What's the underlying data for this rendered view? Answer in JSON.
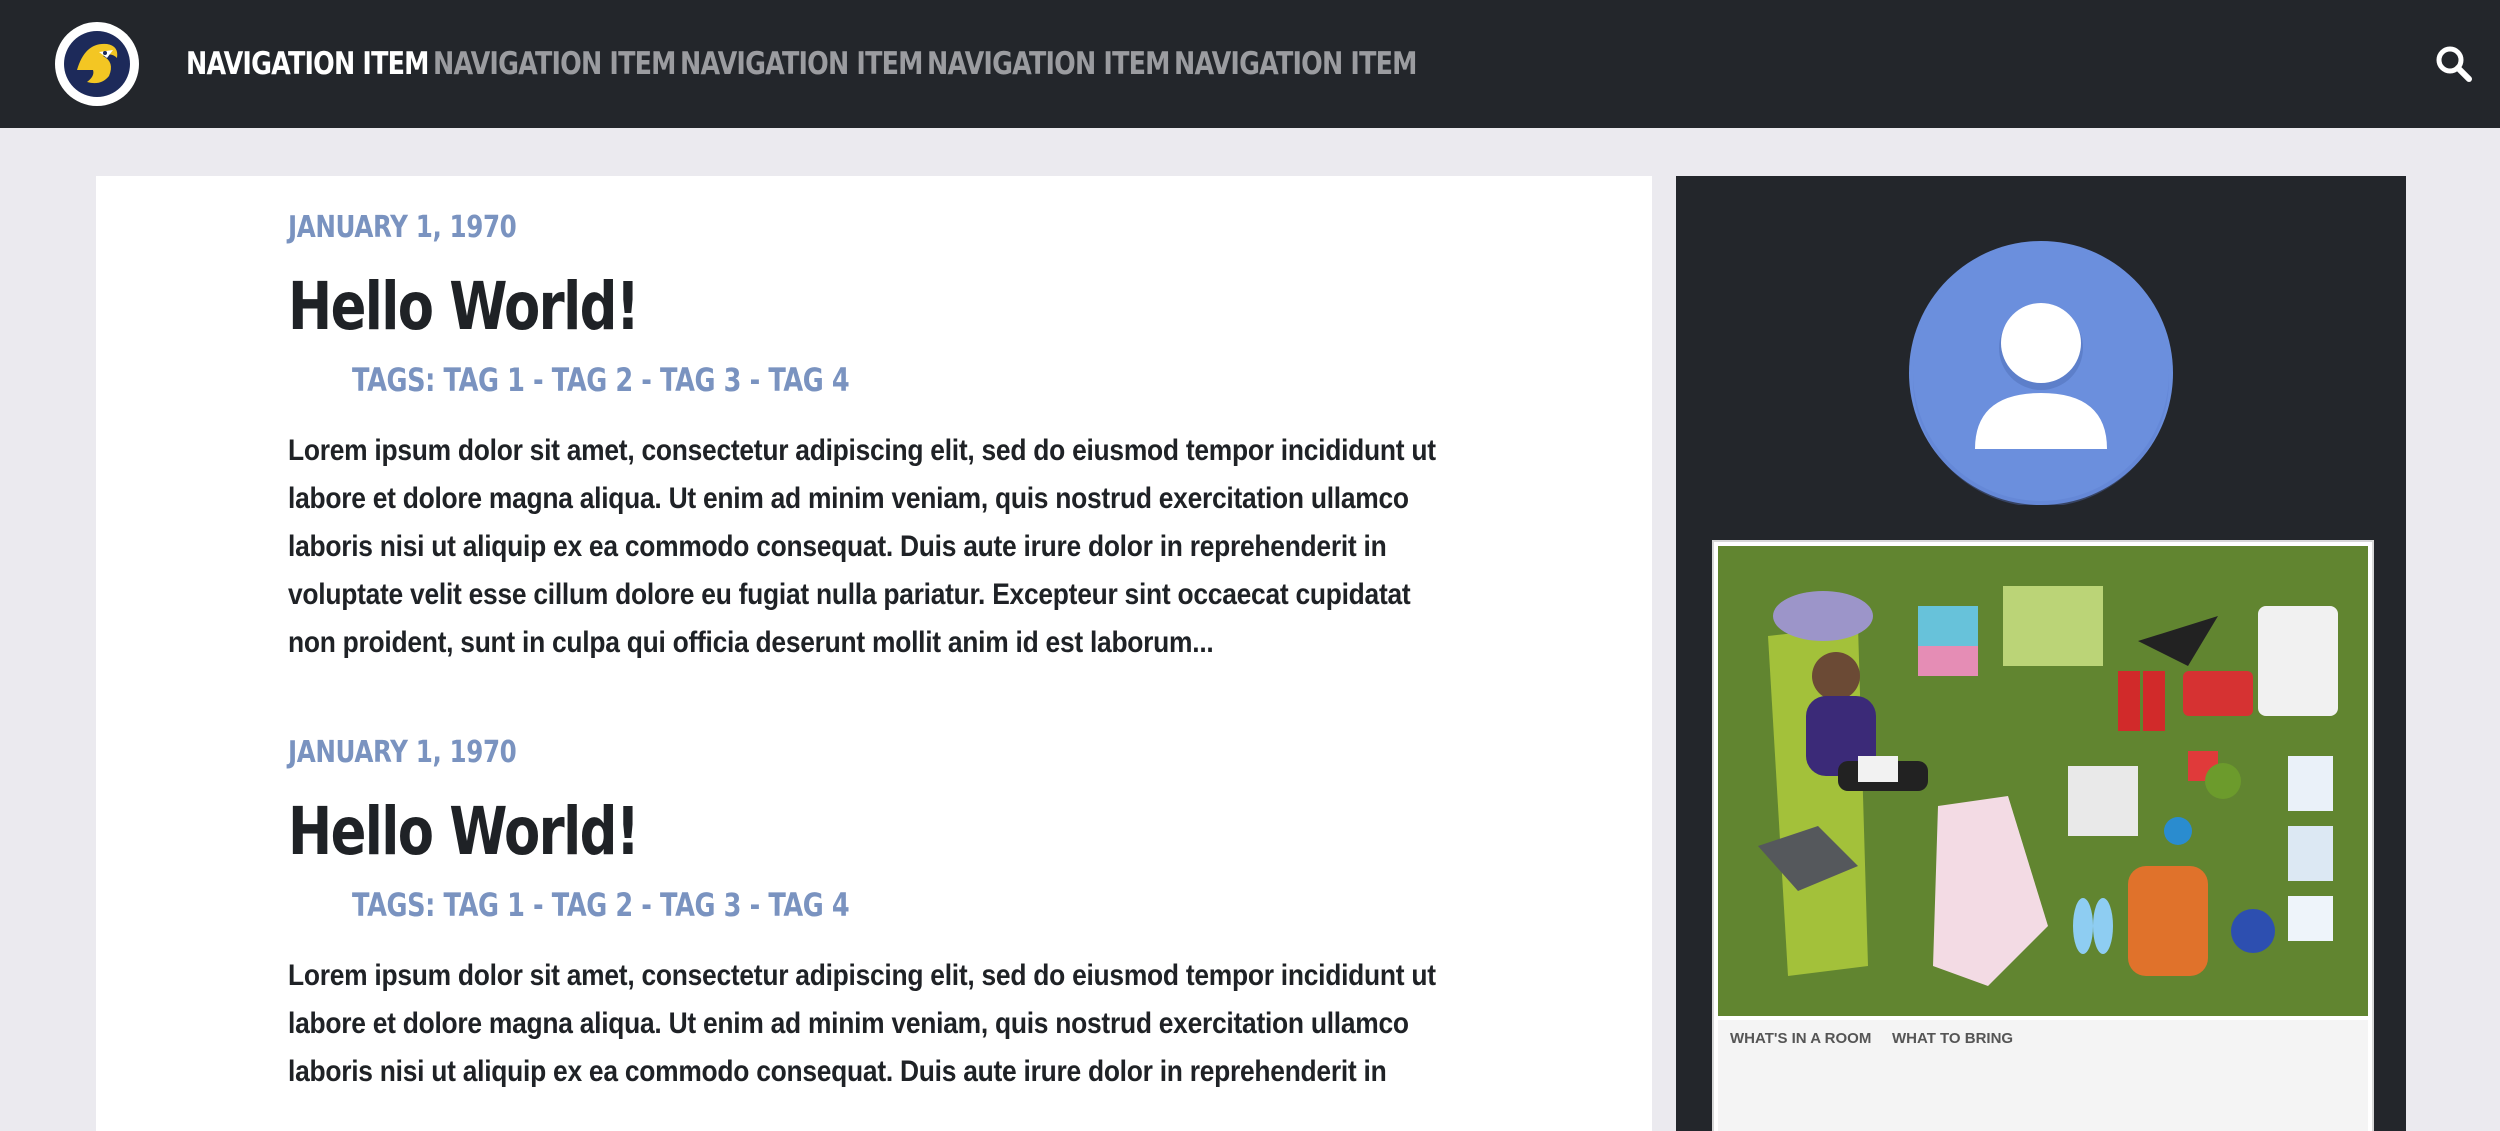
{
  "header": {
    "logo_alt": "mascot-logo",
    "nav_items": [
      {
        "label": "NAVIGATION ITEM",
        "active": true
      },
      {
        "label": "NAVIGATION ITEM",
        "active": false
      },
      {
        "label": "NAVIGATION ITEM",
        "active": false
      },
      {
        "label": "NAVIGATION ITEM",
        "active": false
      },
      {
        "label": "NAVIGATION ITEM",
        "active": false
      }
    ],
    "search_icon": "search-icon"
  },
  "posts": [
    {
      "date": "JANUARY 1, 1970",
      "title": "Hello World!",
      "tags": "TAGS: TAG 1 - TAG 2 - TAG 3 - TAG 4",
      "body": "Lorem ipsum dolor sit amet, consectetur adipiscing elit, sed do eiusmod tempor incididunt ut labore et dolore magna aliqua. Ut enim ad minim veniam, quis nostrud exercitation ullamco laboris nisi ut aliquip ex ea commodo consequat. Duis aute irure dolor in reprehenderit in voluptate velit esse cillum dolore eu fugiat nulla pariatur. Excepteur sint occaecat cupidatat non proident, sunt in culpa qui officia deserunt mollit anim id est laborum..."
    },
    {
      "date": "JANUARY 1, 1970",
      "title": "Hello World!",
      "tags": "TAGS: TAG 1 - TAG 2 - TAG 3 - TAG 4",
      "body": "Lorem ipsum dolor sit amet, consectetur adipiscing elit, sed do eiusmod tempor incididunt ut labore et dolore magna aliqua. Ut enim ad minim veniam, quis nostrud exercitation ullamco laboris nisi ut aliquip ex ea commodo consequat. Duis aute irure dolor in reprehenderit in"
    }
  ],
  "sidebar": {
    "avatar_icon": "user-avatar-icon",
    "image_headings": [
      "WHAT'S IN A ROOM",
      "WHAT TO BRING"
    ]
  },
  "colors": {
    "topbar": "#23262b",
    "accent": "#7a93c0",
    "avatar": "#6b8fdd"
  }
}
